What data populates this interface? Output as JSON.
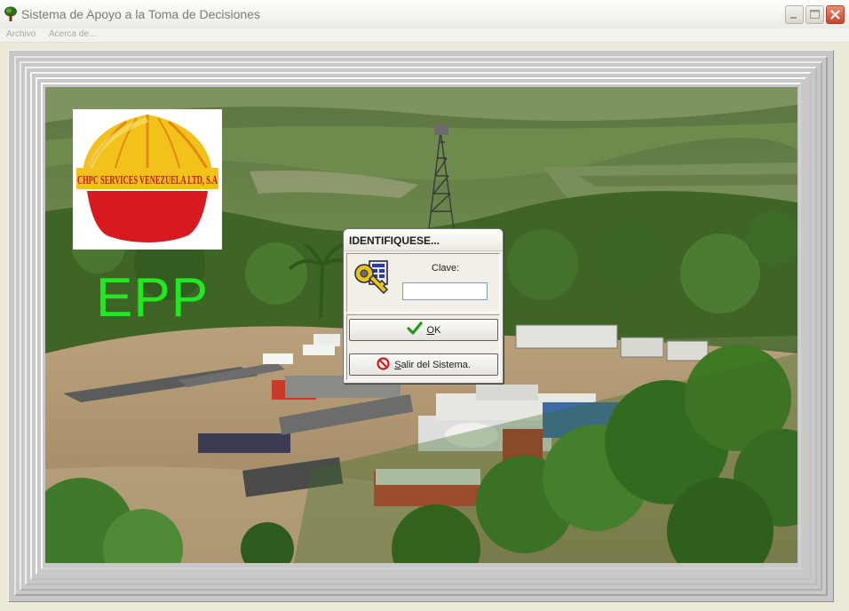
{
  "window": {
    "title": "Sistema de Apoyo a la Toma de Decisiones",
    "icon": "app-tree-icon"
  },
  "menubar": {
    "items": [
      {
        "label": "Archivo"
      },
      {
        "label": "Acerca de..."
      }
    ]
  },
  "splash": {
    "logo_text": "CHPC SERVICES VENEZUELA LTD, S.A",
    "epp_label": "EPP",
    "epp_color": "#22e822"
  },
  "dialog": {
    "title": "IDENTIFIQUESE...",
    "key_icon": "key-icon",
    "clave_label": "Clave:",
    "clave_value": "",
    "ok_mnemonic": "O",
    "ok_rest": "K",
    "exit_mnemonic": "S",
    "exit_rest": "alir del Sistema."
  },
  "colors": {
    "ok_check": "#1e9a1e",
    "exit_icon": "#c81e1e",
    "close_button": "#c6452b"
  }
}
